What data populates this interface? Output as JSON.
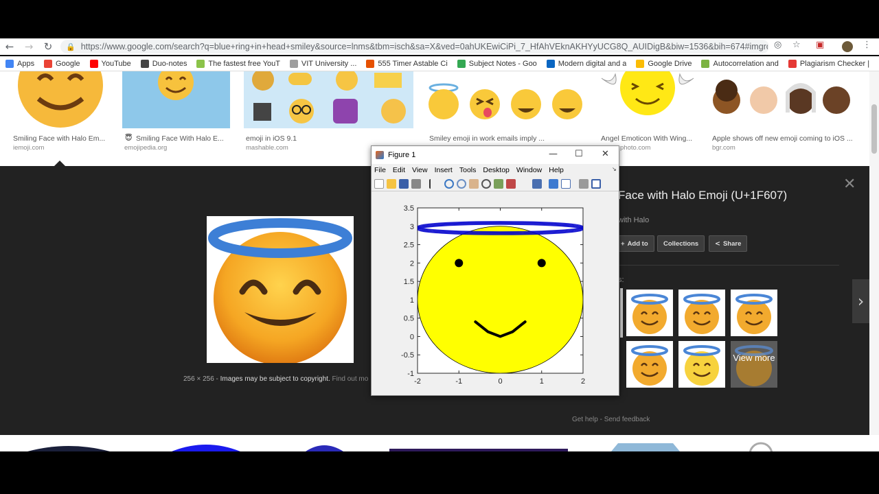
{
  "browser": {
    "url": "https://www.google.com/search?q=blue+ring+in+head+smiley&source=lnms&tbm=isch&sa=X&ved=0ahUKEwiCiPi_7_HfAhVEknAKHYyUCG8Q_AUIDigB&biw=1536&bih=674#imgrc=9JDtPC...",
    "bookmarks": [
      {
        "label": "Apps",
        "color": "#4285f4"
      },
      {
        "label": "Google",
        "color": "#ea4335"
      },
      {
        "label": "YouTube",
        "color": "#ff0000"
      },
      {
        "label": "Duo-notes",
        "color": "#444444"
      },
      {
        "label": "The fastest free YouT",
        "color": "#8bc34a"
      },
      {
        "label": "VIT University ...",
        "color": "#9e9e9e"
      },
      {
        "label": "555 Timer Astable Ci",
        "color": "#e65100"
      },
      {
        "label": "Subject Notes - Goo",
        "color": "#34a853"
      },
      {
        "label": "Modern digital and a",
        "color": "#0a66c2"
      },
      {
        "label": "Google Drive",
        "color": "#fbbc05"
      },
      {
        "label": "Autocorrelation and",
        "color": "#7cb342"
      },
      {
        "label": "Plagiarism Checker |",
        "color": "#e53935"
      }
    ]
  },
  "results": [
    {
      "caption": "Smiling Face with Halo Em...",
      "source": "iemoji.com"
    },
    {
      "caption": "Smiling Face With Halo E...",
      "source": "emojipedia.org"
    },
    {
      "caption": "emoji in iOS 9.1",
      "source": "mashable.com"
    },
    {
      "caption": "Smiley emoji in work emails imply ...",
      "source": ""
    },
    {
      "caption": "Angel Emoticon With Wing...",
      "source": "photo.com"
    },
    {
      "caption": "Apple shows off new emoji coming to iOS ...",
      "source": "bgr.com"
    }
  ],
  "panel": {
    "title": "Face with Halo Emoji (U+1F607)",
    "subtitle": "with Halo",
    "dims": "256 × 256",
    "copyright": "Images may be subject to copyright.",
    "find_out": "Find out mo",
    "buttons": {
      "add": "Add to",
      "collections": "Collections",
      "share": "Share"
    },
    "related_label": "s:",
    "view_more": "View more",
    "get_help": "Get help",
    "send_feedback": "Send feedback"
  },
  "figure": {
    "title": "Figure 1",
    "menu": [
      "File",
      "Edit",
      "View",
      "Insert",
      "Tools",
      "Desktop",
      "Window",
      "Help"
    ]
  },
  "chart_data": {
    "type": "line",
    "title": "",
    "xlabel": "",
    "ylabel": "",
    "xlim": [
      -2,
      2
    ],
    "ylim": [
      -1,
      3.5
    ],
    "xticks": [
      "-2",
      "-1",
      "0",
      "1",
      "2"
    ],
    "yticks": [
      "-1",
      "-0.5",
      "0",
      "0.5",
      "1",
      "1.5",
      "2",
      "2.5",
      "3",
      "3.5"
    ],
    "face": {
      "center": [
        0,
        1
      ],
      "radius": 2,
      "fill": "#ffff00"
    },
    "eyes": [
      {
        "x": -1,
        "y": 2
      },
      {
        "x": 1,
        "y": 2
      }
    ],
    "smile": {
      "x": [
        -0.6,
        -0.3,
        0,
        0.3,
        0.6
      ],
      "y": [
        0.4,
        0.13,
        0.0,
        0.13,
        0.4
      ]
    },
    "halo": {
      "center": [
        0,
        2.95
      ],
      "rx": 2,
      "ry": 0.14,
      "color": "#0000cc"
    }
  }
}
